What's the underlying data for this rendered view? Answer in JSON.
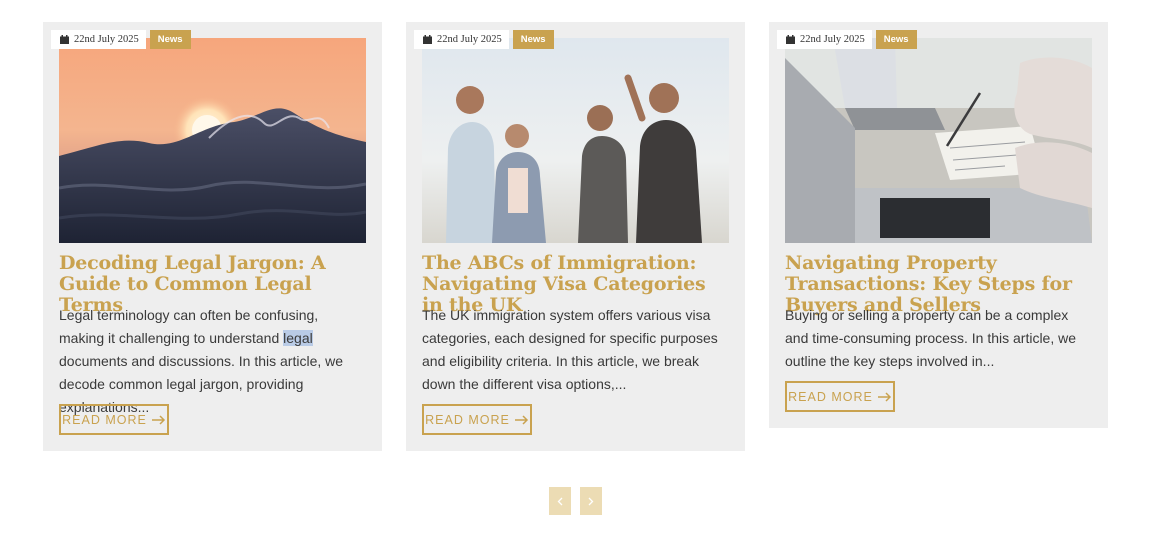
{
  "posts": [
    {
      "date": "22nd July 2025",
      "category": "News",
      "title": "Decoding Legal Jargon: A Guide to Common Legal Terms",
      "excerpt_before": "Legal terminology can often be confusing, making it challenging to understand ",
      "excerpt_selected": "legal",
      "excerpt_after": " documents and discussions. In this article, we decode common legal jargon, providing explanations...",
      "read_more": "READ MORE",
      "image": "sunset-ocean-wave"
    },
    {
      "date": "22nd July 2025",
      "category": "News",
      "title": "The ABCs of Immigration: Navigating Visa Categories in the UK",
      "excerpt": "The UK immigration system offers various visa categories, each designed for specific purposes and eligibility criteria. In this article, we break down the different visa options,...",
      "read_more": "READ MORE",
      "image": "group-of-friends-laughing"
    },
    {
      "date": "22nd July 2025",
      "category": "News",
      "title": "Navigating Property Transactions: Key Steps for Buyers and Sellers",
      "excerpt": "Buying or selling a property can be a complex and time-consuming process. In this article, we outline the key steps involved in...",
      "read_more": "READ MORE",
      "image": "laptops-and-documents"
    }
  ],
  "icons": {
    "date": "calendar-icon",
    "read_more": "arrow-right-icon",
    "prev": "chevron-left-icon",
    "next": "chevron-right-icon"
  },
  "colors": {
    "accent": "#c9a24f",
    "card_bg": "#eeeeee",
    "pager_bg": "#ecdcb4",
    "text": "#3a3a3a"
  }
}
